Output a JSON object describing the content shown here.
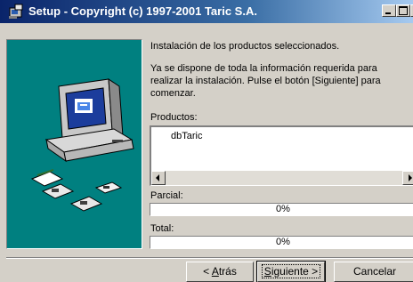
{
  "window": {
    "title": "Setup - Copyright (c) 1997-2001 Taric S.A.",
    "title_icon": "setup-installer-icon",
    "controls": [
      "minimize-icon",
      "maximize-icon",
      "close-icon"
    ],
    "titlebar_color": "#0a246a"
  },
  "main": {
    "heading": "Instalación de los productos seleccionados.",
    "body_lines": [
      "Ya se dispone de toda la información requerida para",
      "realizar la instalación. Pulse el botón [Siguiente] para",
      "comenzar."
    ],
    "products_label": "Productos:",
    "products": [
      "dbTaric"
    ]
  },
  "progress": {
    "partial_label": "Parcial:",
    "partial_value": "0%",
    "partial_fraction": 0,
    "total_label": "Total:",
    "total_value": "0%",
    "total_fraction": 0
  },
  "buttons": {
    "back_prefix": "< ",
    "back_key": "A",
    "back_rest": "trás",
    "next_key": "S",
    "next_rest": "iguiente >",
    "cancel": "Cancelar"
  },
  "colors": {
    "dialog_bg": "#d4d0c8",
    "art_bg": "#008080"
  }
}
